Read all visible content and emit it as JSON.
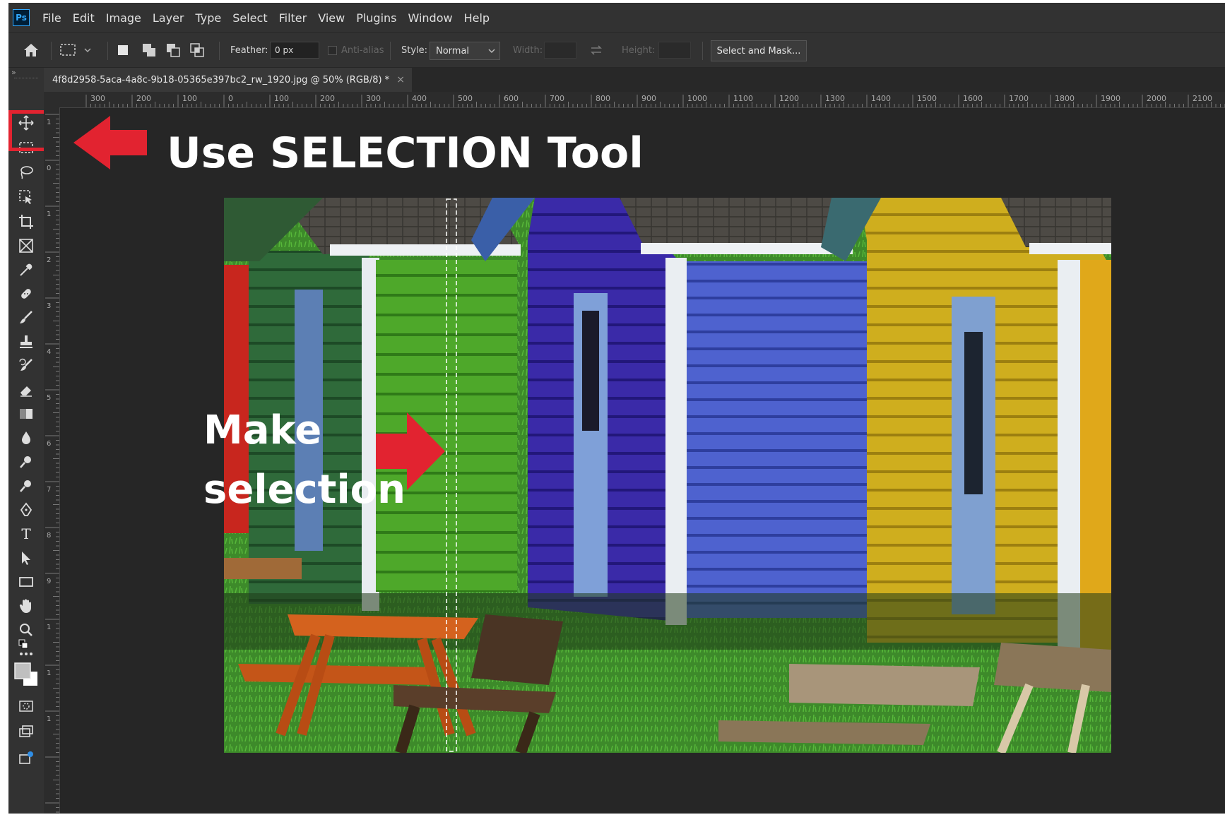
{
  "app": {
    "logo_text": "Ps",
    "menu": [
      "File",
      "Edit",
      "Image",
      "Layer",
      "Type",
      "Select",
      "Filter",
      "View",
      "Plugins",
      "Window",
      "Help"
    ]
  },
  "options_bar": {
    "feather_label": "Feather:",
    "feather_value": "0 px",
    "antialias_label": "Anti-alias",
    "style_label": "Style:",
    "style_value": "Normal",
    "width_label": "Width:",
    "height_label": "Height:",
    "select_mask_label": "Select and Mask..."
  },
  "document": {
    "tab_title": "4f8d2958-5aca-4a8c-9b18-05365e397bc2_rw_1920.jpg @ 50% (RGB/8) *",
    "close_glyph": "×"
  },
  "ruler": {
    "h_ticks": [
      "300",
      "200",
      "100",
      "0",
      "100",
      "200",
      "300",
      "400",
      "500",
      "600",
      "700",
      "800",
      "900",
      "1000",
      "1100",
      "1200",
      "1300",
      "1400",
      "1500",
      "1600",
      "1700",
      "1800",
      "1900",
      "2000",
      "2100"
    ],
    "v_ticks": [
      "1",
      "0",
      "1",
      "2",
      "3",
      "4",
      "5",
      "6",
      "7",
      "8",
      "9",
      "1",
      "1",
      "1"
    ]
  },
  "tools": [
    {
      "name": "move-tool-icon"
    },
    {
      "name": "rectangular-marquee-tool-icon"
    },
    {
      "name": "lasso-tool-icon"
    },
    {
      "name": "object-selection-tool-icon"
    },
    {
      "name": "crop-tool-icon"
    },
    {
      "name": "frame-tool-icon"
    },
    {
      "name": "eyedropper-tool-icon"
    },
    {
      "name": "healing-brush-tool-icon"
    },
    {
      "name": "brush-tool-icon"
    },
    {
      "name": "clone-stamp-tool-icon"
    },
    {
      "name": "history-brush-tool-icon"
    },
    {
      "name": "eraser-tool-icon"
    },
    {
      "name": "gradient-tool-icon"
    },
    {
      "name": "blur-tool-icon"
    },
    {
      "name": "dodge-tool-icon"
    },
    {
      "name": "magnify-dodge-tool-icon"
    },
    {
      "name": "pen-tool-icon"
    },
    {
      "name": "type-tool-icon"
    },
    {
      "name": "path-selection-tool-icon"
    },
    {
      "name": "rectangle-tool-icon"
    },
    {
      "name": "hand-tool-icon"
    },
    {
      "name": "zoom-tool-icon"
    },
    {
      "name": "edit-toolbar-icon"
    }
  ],
  "type_tool_glyph": "T",
  "more_tools_glyph": "•••",
  "callouts": {
    "selection_tool": "Use SELECTION Tool",
    "make_selection_line1": "Make",
    "make_selection_line2": "selection"
  },
  "colors": {
    "accent_red": "#e22330",
    "ui_bg": "#323232",
    "canvas_bg": "#262626"
  }
}
